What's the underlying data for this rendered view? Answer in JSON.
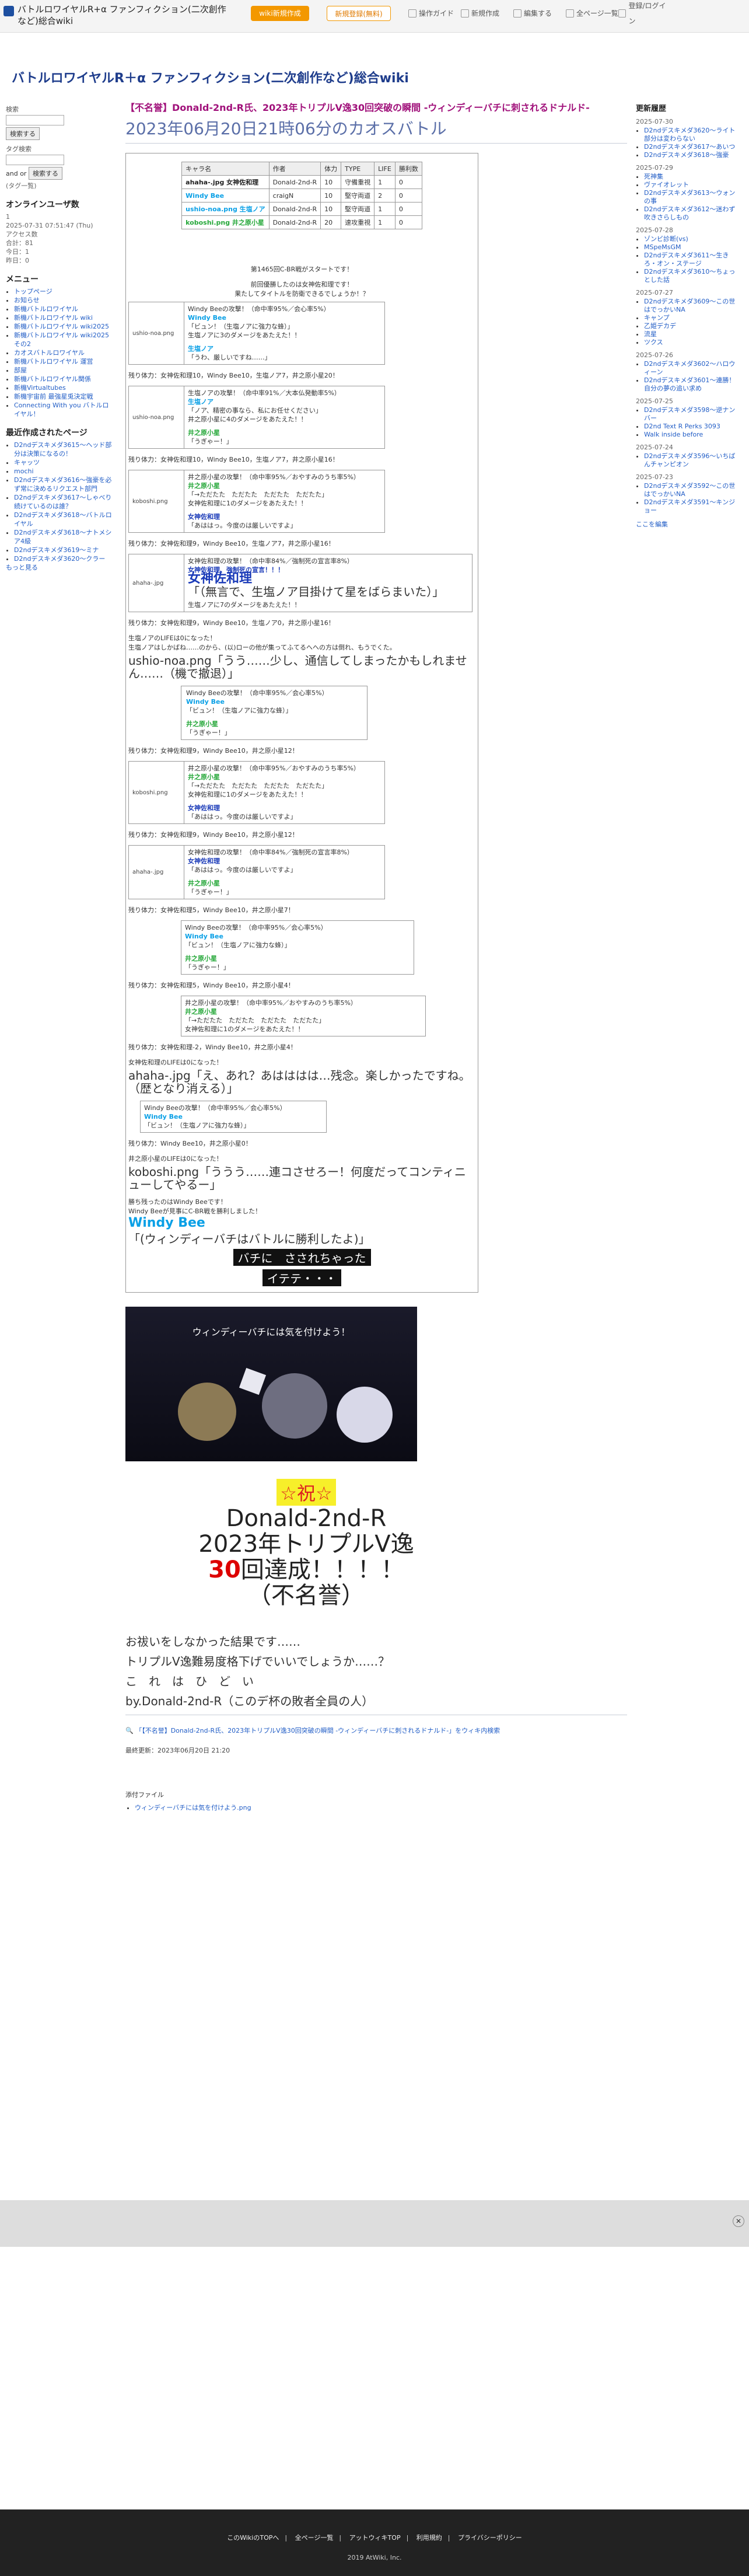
{
  "topbar": {
    "site_title": "バトルロワイヤルR+α ファンフィクション(二次創作など)総合wiki",
    "create_wiki": "wiki新規作成",
    "login": "新規登録(無料)",
    "nav": [
      "操作ガイド",
      "新規作成",
      "編集する",
      "全ページ一覧",
      "登録/ログイン"
    ]
  },
  "header": {
    "wiki_title": "バトルロワイヤルR＋α ファンフィクション(二次創作など)総合wiki"
  },
  "left": {
    "search_label": "検索",
    "search_btn": "検索する",
    "tag_label": "タグ検索",
    "and": "and",
    "or": "or",
    "tag_btn": "検索する",
    "tag_help": "(タグ一覧)",
    "online": "オンラインユーザ数",
    "online_count": "1",
    "online_time": "2025-07-31 07:51:47 (Thu)",
    "access": "アクセス数",
    "access_total": "合計：81",
    "access_today": "今日：1",
    "access_yesterday": "昨日：0",
    "menu_title": "メニュー",
    "menu": [
      "トップページ",
      "お知らせ",
      "新機バトルロワイヤル",
      "新機バトルロワイヤル wiki",
      "新機バトルロワイヤル wiki2025",
      "新機バトルロワイヤル wiki2025その2",
      "カオスバトルロワイヤル",
      "新機バトルロワイヤル 運営",
      "部屋",
      "新機バトルロワイヤル関係",
      "新機Virtualtubes",
      "新機宇宙前 最強星兎決定戦",
      "Connecting With you バトルロイヤル！"
    ],
    "recent_title": "最近作成されたページ",
    "recent": [
      "D2ndデスキメダ3615～ヘッド部分は決策になるの！",
      "キャッツ",
      "mochi",
      "D2ndデスキメダ3616～強豪を必ず常に決めるリクエスト部門",
      "D2ndデスキメダ3617～しゃべり続けているのは誰？",
      "D2ndデスキメダ3618～バトルロイヤル",
      "D2ndデスキメダ3618～ナトメシア4級",
      "D2ndデスキメダ3619～ミナ",
      "D2ndデスキメダ3620～クラー"
    ],
    "more": "もっと見る"
  },
  "right": {
    "title": "更新履歴",
    "groups": [
      {
        "date": "2025-07-30",
        "items": [
          "D2ndデスキメダ3620～ライト部分は変わらない",
          "D2ndデスキメダ3617～あいつ",
          "D2ndデスキメダ3618～強豪"
        ]
      },
      {
        "date": "2025-07-29",
        "items": [
          "死神集",
          "ヴァイオレット",
          "D2ndデスキメダ3613～ウォンの事",
          "D2ndデスキメダ3612～迷わず吹きさらしもの"
        ]
      },
      {
        "date": "2025-07-28",
        "items": [
          "ゾンビ診断(vs)",
          "MSpeMsGM",
          "D2ndデスキメダ3611～生きろ・オン・ステージ",
          "D2ndデスキメダ3610～ちょっとした話"
        ]
      },
      {
        "date": "2025-07-27",
        "items": [
          "D2ndデスキメダ3609～この世はでっかいNA",
          "キャンプ",
          "乙姫デカデ",
          "流星",
          "ツクス"
        ]
      },
      {
        "date": "2025-07-26",
        "items": [
          "D2ndデスキメダ3602～ハロウィーン",
          "D2ndデスキメダ3601～連勝！自分の夢の追い求め"
        ]
      },
      {
        "date": "2025-07-25",
        "items": [
          "D2ndデスキメダ3598～逆ナンバー",
          "D2nd Text R Perks 3093",
          "Walk inside before"
        ]
      },
      {
        "date": "2025-07-24",
        "items": [
          "D2ndデスキメダ3596～いちばんチャンピオン"
        ]
      },
      {
        "date": "2025-07-23",
        "items": [
          "D2ndデスキメダ3592～この世はでっかいNA",
          "D2ndデスキメダ3591～キンジョー"
        ]
      }
    ],
    "more": "ここを編集"
  },
  "main": {
    "title": "【不名誉】Donald-2nd-R氏、2023年トリプルV逸30回突破の瞬間 -ウィンディーバチに刺されるドナルド-",
    "subtitle": "2023年06月20日21時06分のカオスバトル",
    "table_headers": [
      "キャラ名",
      "作者",
      "体力",
      "TYPE",
      "LIFE",
      "勝利数"
    ],
    "table_rows": [
      [
        "ahaha-.jpg 女神佐和理",
        "Donald-2nd-R",
        "10",
        "守備重視",
        "1",
        "0"
      ],
      [
        "Windy Bee",
        "craigN",
        "10",
        "堅守両道",
        "2",
        "0"
      ],
      [
        "ushio-noa.png 生塩ノア",
        "Donald-2nd-R",
        "10",
        "堅守両道",
        "1",
        "0"
      ],
      [
        "koboshi.png 井之原小星",
        "Donald-2nd-R",
        "20",
        "速攻重視",
        "1",
        "0"
      ]
    ],
    "start_text": "第1465回C-BR戦がスタートです！",
    "start_text2": "前回優勝したのは女神佐和理です！",
    "start_text3": "果たしてタイトルを防衛できるでしょうか！？",
    "bee_attack": "Windy Beeの攻撃！（命中率95%／会心率5%）",
    "bee_name": "Windy Bee",
    "bee_line": "「ビュン！（生塩ノアに強力な蜂）」",
    "bee_damage": "生塩ノアに3のダメージをあたえた！！",
    "noa_name": "生塩ノア",
    "noa_line": "「うわ、厳しいですね……」",
    "hp1": "残り体力：女神佐和理10，Windy Bee10，生塩ノア7，井之原小星20！",
    "noa_attack": "生塩ノアの攻撃！（命中率91%／大本仏発動率5%）",
    "noa_line2": "「ノア、精密の事なら、私にお任せください」",
    "noa_damage": "井之原小星に4のダメージをあたえた！！",
    "koboshi_name": "井之原小星",
    "koboshi_line": "「うぎゃー！」",
    "hp2": "残り体力：女神佐和理10，Windy Bee10，生塩ノア7，井之原小星16！",
    "kob_attack": "井之原小星の攻撃！（命中率95%／おやすみのうち率5%）",
    "kob_line": "「→ただたた　ただたた　ただたた　ただたた」",
    "kob_damage": "女神佐和理に1のダメージをあたえた！！",
    "megami_name": "女神佐和理",
    "megami_line": "「あははっ。今度のは厳しいですよ」",
    "hp3": "残り体力：女神佐和理9，Windy Bee10，生塩ノア7，井之原小星16！",
    "megami_attack": "女神佐和理の攻撃！（命中率84%／強制死の宣言率8%）",
    "megami_special": "女神佐和理、強制死の宣言！！！",
    "megami_big_name": "女神佐和理",
    "megami_big_line": "「（無言で、生塩ノア目掛けて星をばらまいた）」",
    "megami_damage": "生塩ノアに7のダメージをあたえた！！",
    "hp4": "残り体力：女神佐和理9，Windy Bee10，生塩ノア0，井之原小星16！",
    "noa_down": "生塩ノアのLIFEは0になった！",
    "noa_down2": "生塩ノアはしかばね……のから、(以)ローの他が集ってふてるへへの方は倒れ、もうでくた。",
    "noa_last": "ushio-noa.png「うう……少し、通信してしまったかもしれません……（機で撤退）」",
    "hp5": "残り体力：女神佐和理9，Windy Bee10，井之原小星12！",
    "hp6": "残り体力：女神佐和理9，Windy Bee10，井之原小星12！",
    "hp7": "残り体力：女神佐和理5，Windy Bee10，井之原小星7！",
    "hp8": "残り体力：女神佐和理5，Windy Bee10，井之原小星4！",
    "hp9": "残り体力：女神佐和理-2，Windy Bee10，井之原小星4！",
    "megami_down": "女神佐和理のLIFEは0になった！",
    "megami_last": "ahaha-.jpg「え、あれ？あはははは…残念。楽しかったですね。（歴となり消える）」",
    "hp10": "残り体力：Windy Bee10，井之原小星0！",
    "kob_down": "井之原小星のLIFEは0になった！",
    "kob_last": "koboshi.png「ううう……連コさせろー！何度だってコンティニューしてやるー」",
    "winner": "勝ち残ったのはWindy Beeです！",
    "winner2": "Windy Beeが見事にC-BR戦を勝利しました！",
    "winner_name": "Windy Bee",
    "winner_line": "「(ウィンディーバチはバトルに勝利したよ)」",
    "band1": "バチに　さされちゃった",
    "band2": "イテテ・・・",
    "banner_caption": "ウィンディーバチには気を付けよう！",
    "congrats_mark": "☆祝☆",
    "congrats_name": "Donald-2nd-R",
    "congrats_line1": "2023年トリプルV逸",
    "congrats_num": "30",
    "congrats_line2": "回達成！！！！",
    "congrats_line3": "（不名誉）",
    "after1": "お祓いをしなかった結果です……",
    "after2": "トリプルV逸難易度格下げでいいでしょうか……？",
    "after3": "こ　れ　は　ひ　ど　い",
    "after4": "by.Donald-2nd-R（このデ杯の敗者全員の人）",
    "footer_link": "「【不名誉】Donald-2nd-R氏、2023年トリプルV逸30回突破の瞬間 -ウィンディーバチに刺されるドナルド-」をウィキ内検索",
    "updated": "最終更新：2023年06月20日 21:20",
    "attach_title": "添付ファイル",
    "attach_item": "ウィンディーバチには気を付けよう.png"
  },
  "footer": {
    "links": [
      "このWikiのTOPへ",
      "全ページ一覧",
      "アットウィキTOP",
      "利用規約",
      "プライバシーポリシー"
    ],
    "copyright": "2019 AtWiki, Inc."
  }
}
